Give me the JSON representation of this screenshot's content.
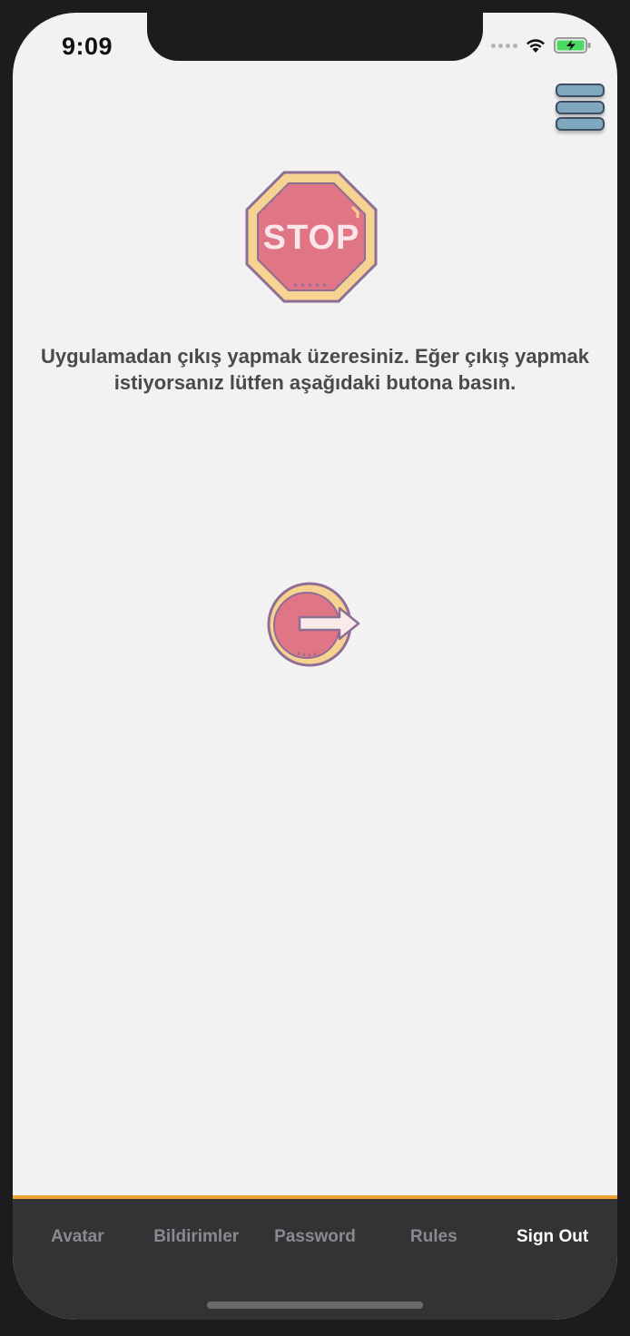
{
  "status_bar": {
    "time": "9:09"
  },
  "header": {
    "menu_icon": "hamburger-menu-icon"
  },
  "main": {
    "stop_icon": "stop-sign-icon",
    "stop_text": "STOP",
    "message": "Uygulamadan çıkış yapmak üzeresiniz. Eğer çıkış yapmak istiyorsanız lütfen aşağıdaki butona basın.",
    "signout_icon": "sign-out-icon"
  },
  "tabbar": {
    "accent": "#f0a232",
    "items": [
      {
        "label": "Avatar"
      },
      {
        "label": "Bildirimler"
      },
      {
        "label": "Password"
      },
      {
        "label": "Rules"
      },
      {
        "label": "Sign Out"
      }
    ],
    "active_index": 4
  },
  "colors": {
    "background": "#f2f2f2",
    "tabbar_bg": "#333335",
    "stop_fill": "#e07586",
    "stop_border": "#f6d391",
    "icon_outline": "#8f6e96"
  }
}
